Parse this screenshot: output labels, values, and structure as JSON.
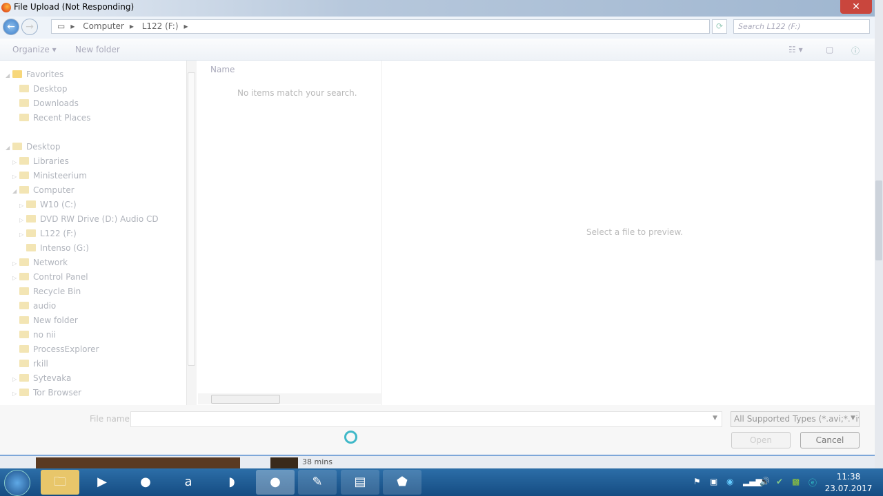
{
  "window": {
    "title": "File Upload (Not Responding)",
    "close": "✕"
  },
  "address": {
    "crumbs": [
      "Computer",
      "L122 (F:)"
    ],
    "search_placeholder": "Search L122 (F:)"
  },
  "toolbar": {
    "organize": "Organize ▾",
    "new_folder": "New folder"
  },
  "nav": [
    {
      "label": "Favorites",
      "level": 0,
      "arrow": "◢",
      "group": true
    },
    {
      "label": "Desktop",
      "level": 1
    },
    {
      "label": "Downloads",
      "level": 1
    },
    {
      "label": "Recent Places",
      "level": 1
    },
    {
      "label": "Desktop",
      "level": 0,
      "arrow": "◢",
      "group": true,
      "gap": true
    },
    {
      "label": "Libraries",
      "level": 1,
      "arrow": "▷"
    },
    {
      "label": "Ministeerium",
      "level": 1,
      "arrow": "▷"
    },
    {
      "label": "Computer",
      "level": 1,
      "arrow": "◢"
    },
    {
      "label": "W10 (C:)",
      "level": 2,
      "arrow": "▷"
    },
    {
      "label": "DVD RW Drive (D:) Audio CD",
      "level": 2,
      "arrow": "▷"
    },
    {
      "label": "L122 (F:)",
      "level": 2,
      "arrow": "▷"
    },
    {
      "label": "Intenso (G:)",
      "level": 2
    },
    {
      "label": "Network",
      "level": 1,
      "arrow": "▷"
    },
    {
      "label": "Control Panel",
      "level": 1,
      "arrow": "▷"
    },
    {
      "label": "Recycle Bin",
      "level": 1
    },
    {
      "label": "audio",
      "level": 1
    },
    {
      "label": "New folder",
      "level": 1
    },
    {
      "label": "no nii",
      "level": 1
    },
    {
      "label": "ProcessExplorer",
      "level": 1
    },
    {
      "label": "rkill",
      "level": 1
    },
    {
      "label": "Sytevaka",
      "level": 1,
      "arrow": "▷"
    },
    {
      "label": "Tor Browser",
      "level": 1,
      "arrow": "▷"
    }
  ],
  "list": {
    "column_name": "Name",
    "empty": "No items match your search."
  },
  "preview": {
    "text": "Select a file to preview."
  },
  "bottom": {
    "file_name_label": "File name:",
    "file_name_value": "",
    "filter": "All Supported Types (*.avi;*.div;",
    "open": "Open",
    "cancel": "Cancel"
  },
  "strip": {
    "text": "38 mins"
  },
  "taskbar": {
    "time": "11:38",
    "date": "23.07.2017"
  }
}
